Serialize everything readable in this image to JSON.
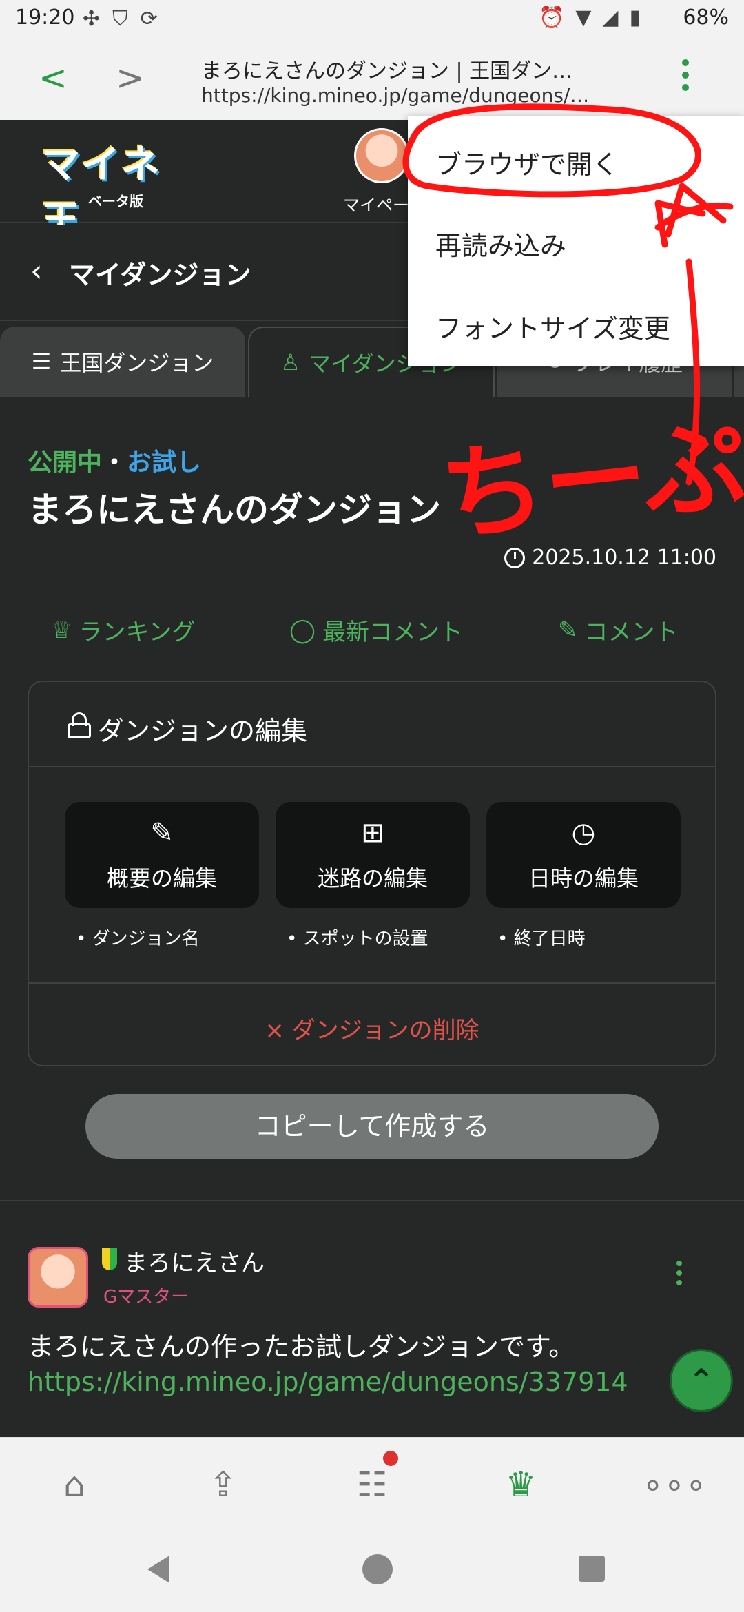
{
  "status_bar": {
    "time": "19:20",
    "battery": "68%"
  },
  "browser": {
    "page_title": "まろにえさんのダンジョン | 王国ダン…",
    "url": "https://king.mineo.jp/game/dungeons/…"
  },
  "overflow_menu": {
    "items": [
      "ブラウザで開く",
      "再読み込み",
      "フォントサイズ変更"
    ]
  },
  "site_header": {
    "logo_text": "マイネ王",
    "logo_sub": "ベータ版",
    "mypage_label": "マイペー"
  },
  "back_row": {
    "title": "マイダンジョン"
  },
  "tabs": [
    "王国ダンジョン",
    "マイダンジョン",
    "プレイ履歴"
  ],
  "dungeon": {
    "status_public": "公開中",
    "status_sep": "・",
    "status_trial": "お試し",
    "title": "まろにえさんのダンジョン",
    "date": "2025.10.12 11:00"
  },
  "actions": [
    "ランキング",
    "最新コメント",
    "コメント"
  ],
  "edit_card": {
    "title": "ダンジョンの編集",
    "buttons": [
      {
        "label": "概要の編集",
        "bullet": "ダンジョン名"
      },
      {
        "label": "迷路の編集",
        "bullet": "スポットの設置"
      },
      {
        "label": "日時の編集",
        "bullet": "終了日時"
      }
    ],
    "delete_label": "× ダンジョンの削除"
  },
  "copy_button": "コピーして作成する",
  "post": {
    "user": "まろにえさん",
    "rank": "Gマスター",
    "text": "まろにえさんの作ったお試しダンジョンです。",
    "link": "https://king.mineo.jp/game/dungeons/337914"
  },
  "annotation_text": "ちーぷ",
  "colors": {
    "accent": "#4cb35c",
    "trial": "#3ea4e8",
    "danger": "#e0524a",
    "annotation": "#ff0000"
  }
}
